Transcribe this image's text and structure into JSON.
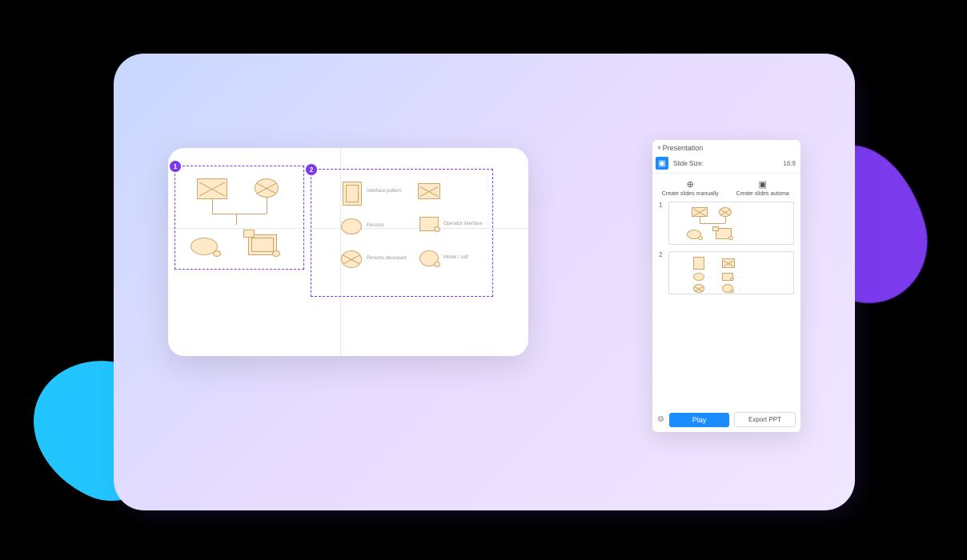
{
  "canvas": {
    "selection1_badge": "1",
    "selection2_badge": "2",
    "labels": {
      "interface_pattern": "Interface pattern",
      "persons": "Persons",
      "persons_deceased": "Persons deceased",
      "operator_interface": "Operator interface",
      "model": "Model / self"
    }
  },
  "panel": {
    "title": "Presentation",
    "slide_size_label": "Slide Size:",
    "slide_size_value": "16:9",
    "mode_manual": "Create slides manually",
    "mode_auto": "Create slides automa",
    "slide1_num": "1",
    "slide2_num": "2",
    "play": "Play",
    "export": "Export PPT"
  }
}
